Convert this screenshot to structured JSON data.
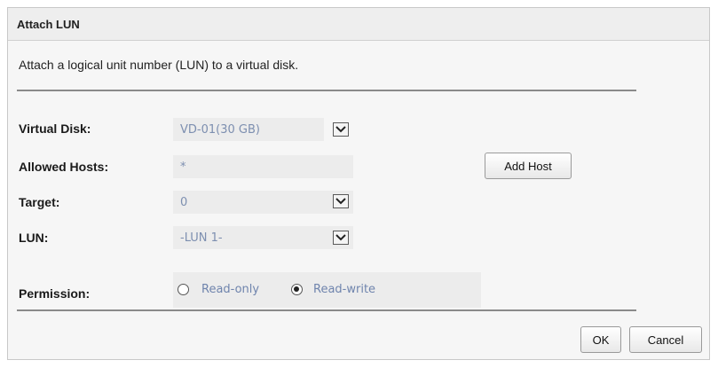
{
  "dialog": {
    "title": "Attach LUN",
    "description": "Attach a logical unit number (LUN) to a virtual disk."
  },
  "form": {
    "virtual_disk": {
      "label": "Virtual Disk:",
      "value": "VD-01(30 GB)"
    },
    "allowed_hosts": {
      "label": "Allowed Hosts:",
      "value": "*"
    },
    "target": {
      "label": "Target:",
      "value": "0"
    },
    "lun": {
      "label": "LUN:",
      "value": "-LUN 1-"
    },
    "permission": {
      "label": "Permission:",
      "options": [
        {
          "label": "Read-only",
          "selected": false
        },
        {
          "label": "Read-write",
          "selected": true
        }
      ]
    }
  },
  "buttons": {
    "add_host": "Add Host",
    "ok": "OK",
    "cancel": "Cancel"
  },
  "icons": {
    "dropdown": "chevron-down-icon"
  }
}
